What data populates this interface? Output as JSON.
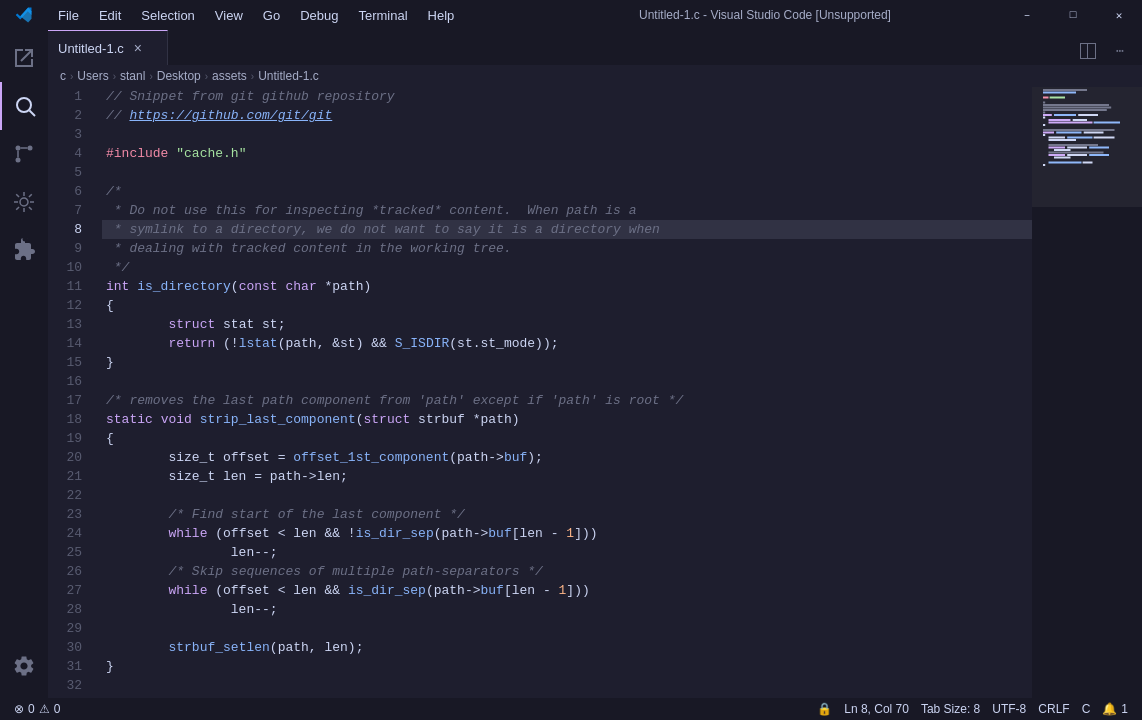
{
  "titleBar": {
    "title": "Untitled-1.c - Visual Studio Code [Unsupported]",
    "menu": [
      "File",
      "Edit",
      "Selection",
      "View",
      "Go",
      "Debug",
      "Terminal",
      "Help"
    ]
  },
  "tab": {
    "filename": "Untitled-1.c",
    "close": "×"
  },
  "breadcrumb": {
    "parts": [
      "c",
      "Users",
      "stanl",
      "Desktop",
      "assets",
      "Untitled-1.c"
    ]
  },
  "statusBar": {
    "errors": "0",
    "warnings": "0",
    "position": "Ln 8, Col 70",
    "tabSize": "Tab Size: 8",
    "encoding": "UTF-8",
    "lineEnding": "CRLF",
    "language": "C",
    "bell": "1",
    "git": ""
  },
  "code": {
    "lines": [
      {
        "n": 1,
        "text": "// Snippet from git github repository"
      },
      {
        "n": 2,
        "text": "// https://github.com/git/git"
      },
      {
        "n": 3,
        "text": ""
      },
      {
        "n": 4,
        "text": "#include \"cache.h\""
      },
      {
        "n": 5,
        "text": ""
      },
      {
        "n": 6,
        "text": "/*"
      },
      {
        "n": 7,
        "text": " * Do not use this for inspecting *tracked* content.  When path is a"
      },
      {
        "n": 8,
        "text": " * symlink to a directory, we do not want to say it is a directory when"
      },
      {
        "n": 9,
        "text": " * dealing with tracked content in the working tree."
      },
      {
        "n": 10,
        "text": " */"
      },
      {
        "n": 11,
        "text": "int is_directory(const char *path)"
      },
      {
        "n": 12,
        "text": "{"
      },
      {
        "n": 13,
        "text": "        struct stat st;"
      },
      {
        "n": 14,
        "text": "        return (!lstat(path, &st) && S_ISDIR(st.st_mode));"
      },
      {
        "n": 15,
        "text": "}"
      },
      {
        "n": 16,
        "text": ""
      },
      {
        "n": 17,
        "text": "/* removes the last path component from 'path' except if 'path' is root */"
      },
      {
        "n": 18,
        "text": "static void strip_last_component(struct strbuf *path)"
      },
      {
        "n": 19,
        "text": "{"
      },
      {
        "n": 20,
        "text": "        size_t offset = offset_1st_component(path->buf);"
      },
      {
        "n": 21,
        "text": "        size_t len = path->len;"
      },
      {
        "n": 22,
        "text": ""
      },
      {
        "n": 23,
        "text": "        /* Find start of the last component */"
      },
      {
        "n": 24,
        "text": "        while (offset < len && !is_dir_sep(path->buf[len - 1]))"
      },
      {
        "n": 25,
        "text": "                len--;"
      },
      {
        "n": 26,
        "text": "        /* Skip sequences of multiple path-separators */"
      },
      {
        "n": 27,
        "text": "        while (offset < len && is_dir_sep(path->buf[len - 1]))"
      },
      {
        "n": 28,
        "text": "                len--;"
      },
      {
        "n": 29,
        "text": ""
      },
      {
        "n": 30,
        "text": "        strbuf_setlen(path, len);"
      },
      {
        "n": 31,
        "text": "}"
      },
      {
        "n": 32,
        "text": ""
      }
    ]
  }
}
